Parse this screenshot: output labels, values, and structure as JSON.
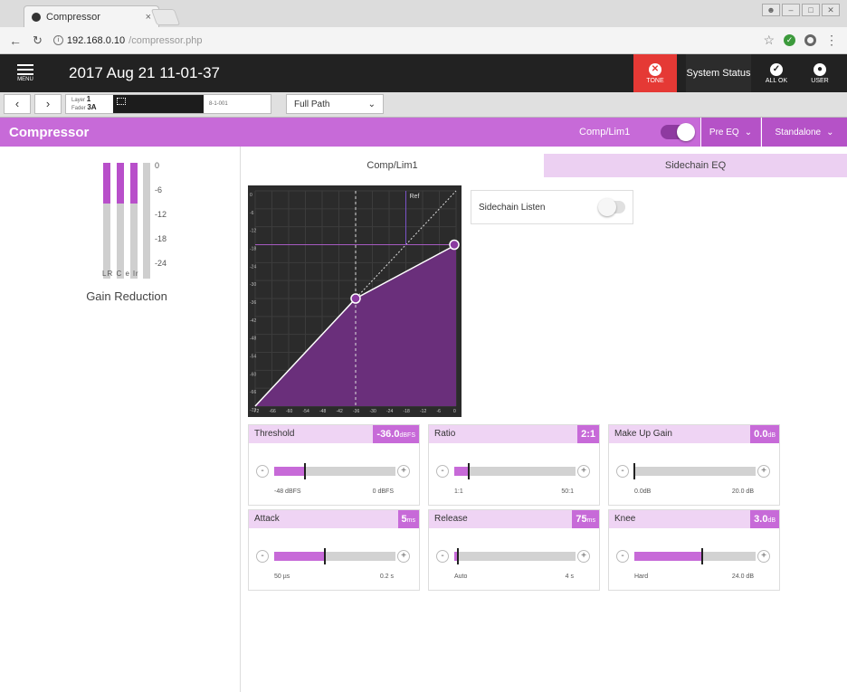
{
  "browser": {
    "tab_title": "Compressor",
    "tab_close": "×",
    "address_host": "192.168.0.10",
    "address_path": "/compressor.php"
  },
  "header": {
    "menu_label": "MENU",
    "datetime": "2017 Aug 21 11-01-37",
    "tone_label": "TONE",
    "system_status": "System Status",
    "all_ok_label": "ALL OK",
    "user_label": "USER"
  },
  "layer": {
    "layer_label": "Layer",
    "layer_value": "1",
    "fader_label": "Fader",
    "fader_value": "3A",
    "channel_id": "8-1-001",
    "path_select": "Full Path"
  },
  "section": {
    "title": "Compressor",
    "comp_lim_label": "Comp/Lim1",
    "comp_lim_on": true,
    "pre_eq": "Pre EQ",
    "standalone": "Standalone"
  },
  "gain_reduction": {
    "label": "Gain Reduction",
    "scale": [
      "0",
      "-6",
      "-12",
      "-18",
      "-24"
    ],
    "meter_labels": "LR C  e  lr",
    "meters": [
      0.35,
      0.35,
      0.35,
      0.0
    ]
  },
  "tabs": {
    "comp_lim": "Comp/Lim1",
    "sidechain_eq": "Sidechain EQ"
  },
  "graph": {
    "ref_label": "Ref",
    "y_ticks": [
      "0",
      "-6",
      "-12",
      "-18",
      "-24",
      "-30",
      "-36",
      "-42",
      "-48",
      "-54",
      "-60",
      "-66",
      "-72"
    ],
    "x_ticks": [
      "-72",
      "-66",
      "-60",
      "-54",
      "-48",
      "-42",
      "-36",
      "-30",
      "-24",
      "-18",
      "-12",
      "-6",
      "0"
    ],
    "threshold_db": -36,
    "ratio": 2,
    "makeup_db": 0
  },
  "sidechain_listen": {
    "label": "Sidechain Listen",
    "on": false
  },
  "params": [
    {
      "id": "threshold",
      "label": "Threshold",
      "value": "-36.0",
      "unit": "dBFS",
      "min": "-48 dBFS",
      "max": "0 dBFS",
      "position": 0.25,
      "fill": true
    },
    {
      "id": "ratio",
      "label": "Ratio",
      "value": "2:1",
      "unit": "",
      "min": "1:1",
      "max": "50:1",
      "position": 0.12,
      "fill": true
    },
    {
      "id": "makeup",
      "label": "Make Up Gain",
      "value": "0.0",
      "unit": "dB",
      "min": "0.0dB",
      "max": "20.0 dB",
      "position": 0.0,
      "fill": true
    },
    {
      "id": "attack",
      "label": "Attack",
      "value": "5",
      "unit": "ms",
      "min": "50 µs",
      "max": "0.2 s",
      "position": 0.42,
      "fill": true
    },
    {
      "id": "release",
      "label": "Release",
      "value": "75",
      "unit": "ms",
      "min": "Auto",
      "max": "4 s",
      "position": 0.03,
      "fill": true
    },
    {
      "id": "knee",
      "label": "Knee",
      "value": "3.0",
      "unit": "dB",
      "min": "Hard",
      "max": "24.0 dB",
      "position": 0.56,
      "fill": true
    }
  ],
  "controls": {
    "minus": "-",
    "plus": "+"
  },
  "colors": {
    "accent": "#c76ad8",
    "accent_light": "#efd4f4",
    "tone_red": "#e53935",
    "header_dark": "#222222"
  }
}
